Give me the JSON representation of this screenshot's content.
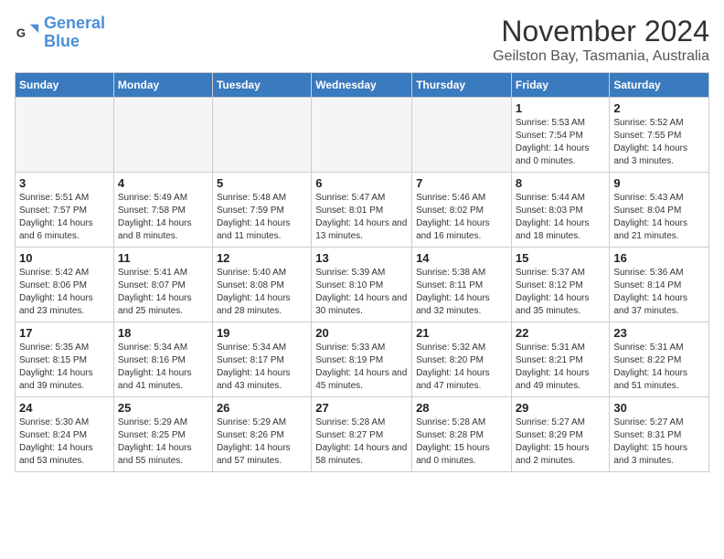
{
  "logo": {
    "line1": "General",
    "line2": "Blue"
  },
  "header": {
    "month": "November 2024",
    "location": "Geilston Bay, Tasmania, Australia"
  },
  "weekdays": [
    "Sunday",
    "Monday",
    "Tuesday",
    "Wednesday",
    "Thursday",
    "Friday",
    "Saturday"
  ],
  "weeks": [
    [
      {
        "day": "",
        "empty": true
      },
      {
        "day": "",
        "empty": true
      },
      {
        "day": "",
        "empty": true
      },
      {
        "day": "",
        "empty": true
      },
      {
        "day": "",
        "empty": true
      },
      {
        "day": "1",
        "sunrise": "Sunrise: 5:53 AM",
        "sunset": "Sunset: 7:54 PM",
        "daylight": "Daylight: 14 hours and 0 minutes."
      },
      {
        "day": "2",
        "sunrise": "Sunrise: 5:52 AM",
        "sunset": "Sunset: 7:55 PM",
        "daylight": "Daylight: 14 hours and 3 minutes."
      }
    ],
    [
      {
        "day": "3",
        "sunrise": "Sunrise: 5:51 AM",
        "sunset": "Sunset: 7:57 PM",
        "daylight": "Daylight: 14 hours and 6 minutes."
      },
      {
        "day": "4",
        "sunrise": "Sunrise: 5:49 AM",
        "sunset": "Sunset: 7:58 PM",
        "daylight": "Daylight: 14 hours and 8 minutes."
      },
      {
        "day": "5",
        "sunrise": "Sunrise: 5:48 AM",
        "sunset": "Sunset: 7:59 PM",
        "daylight": "Daylight: 14 hours and 11 minutes."
      },
      {
        "day": "6",
        "sunrise": "Sunrise: 5:47 AM",
        "sunset": "Sunset: 8:01 PM",
        "daylight": "Daylight: 14 hours and 13 minutes."
      },
      {
        "day": "7",
        "sunrise": "Sunrise: 5:46 AM",
        "sunset": "Sunset: 8:02 PM",
        "daylight": "Daylight: 14 hours and 16 minutes."
      },
      {
        "day": "8",
        "sunrise": "Sunrise: 5:44 AM",
        "sunset": "Sunset: 8:03 PM",
        "daylight": "Daylight: 14 hours and 18 minutes."
      },
      {
        "day": "9",
        "sunrise": "Sunrise: 5:43 AM",
        "sunset": "Sunset: 8:04 PM",
        "daylight": "Daylight: 14 hours and 21 minutes."
      }
    ],
    [
      {
        "day": "10",
        "sunrise": "Sunrise: 5:42 AM",
        "sunset": "Sunset: 8:06 PM",
        "daylight": "Daylight: 14 hours and 23 minutes."
      },
      {
        "day": "11",
        "sunrise": "Sunrise: 5:41 AM",
        "sunset": "Sunset: 8:07 PM",
        "daylight": "Daylight: 14 hours and 25 minutes."
      },
      {
        "day": "12",
        "sunrise": "Sunrise: 5:40 AM",
        "sunset": "Sunset: 8:08 PM",
        "daylight": "Daylight: 14 hours and 28 minutes."
      },
      {
        "day": "13",
        "sunrise": "Sunrise: 5:39 AM",
        "sunset": "Sunset: 8:10 PM",
        "daylight": "Daylight: 14 hours and 30 minutes."
      },
      {
        "day": "14",
        "sunrise": "Sunrise: 5:38 AM",
        "sunset": "Sunset: 8:11 PM",
        "daylight": "Daylight: 14 hours and 32 minutes."
      },
      {
        "day": "15",
        "sunrise": "Sunrise: 5:37 AM",
        "sunset": "Sunset: 8:12 PM",
        "daylight": "Daylight: 14 hours and 35 minutes."
      },
      {
        "day": "16",
        "sunrise": "Sunrise: 5:36 AM",
        "sunset": "Sunset: 8:14 PM",
        "daylight": "Daylight: 14 hours and 37 minutes."
      }
    ],
    [
      {
        "day": "17",
        "sunrise": "Sunrise: 5:35 AM",
        "sunset": "Sunset: 8:15 PM",
        "daylight": "Daylight: 14 hours and 39 minutes."
      },
      {
        "day": "18",
        "sunrise": "Sunrise: 5:34 AM",
        "sunset": "Sunset: 8:16 PM",
        "daylight": "Daylight: 14 hours and 41 minutes."
      },
      {
        "day": "19",
        "sunrise": "Sunrise: 5:34 AM",
        "sunset": "Sunset: 8:17 PM",
        "daylight": "Daylight: 14 hours and 43 minutes."
      },
      {
        "day": "20",
        "sunrise": "Sunrise: 5:33 AM",
        "sunset": "Sunset: 8:19 PM",
        "daylight": "Daylight: 14 hours and 45 minutes."
      },
      {
        "day": "21",
        "sunrise": "Sunrise: 5:32 AM",
        "sunset": "Sunset: 8:20 PM",
        "daylight": "Daylight: 14 hours and 47 minutes."
      },
      {
        "day": "22",
        "sunrise": "Sunrise: 5:31 AM",
        "sunset": "Sunset: 8:21 PM",
        "daylight": "Daylight: 14 hours and 49 minutes."
      },
      {
        "day": "23",
        "sunrise": "Sunrise: 5:31 AM",
        "sunset": "Sunset: 8:22 PM",
        "daylight": "Daylight: 14 hours and 51 minutes."
      }
    ],
    [
      {
        "day": "24",
        "sunrise": "Sunrise: 5:30 AM",
        "sunset": "Sunset: 8:24 PM",
        "daylight": "Daylight: 14 hours and 53 minutes."
      },
      {
        "day": "25",
        "sunrise": "Sunrise: 5:29 AM",
        "sunset": "Sunset: 8:25 PM",
        "daylight": "Daylight: 14 hours and 55 minutes."
      },
      {
        "day": "26",
        "sunrise": "Sunrise: 5:29 AM",
        "sunset": "Sunset: 8:26 PM",
        "daylight": "Daylight: 14 hours and 57 minutes."
      },
      {
        "day": "27",
        "sunrise": "Sunrise: 5:28 AM",
        "sunset": "Sunset: 8:27 PM",
        "daylight": "Daylight: 14 hours and 58 minutes."
      },
      {
        "day": "28",
        "sunrise": "Sunrise: 5:28 AM",
        "sunset": "Sunset: 8:28 PM",
        "daylight": "Daylight: 15 hours and 0 minutes."
      },
      {
        "day": "29",
        "sunrise": "Sunrise: 5:27 AM",
        "sunset": "Sunset: 8:29 PM",
        "daylight": "Daylight: 15 hours and 2 minutes."
      },
      {
        "day": "30",
        "sunrise": "Sunrise: 5:27 AM",
        "sunset": "Sunset: 8:31 PM",
        "daylight": "Daylight: 15 hours and 3 minutes."
      }
    ]
  ]
}
